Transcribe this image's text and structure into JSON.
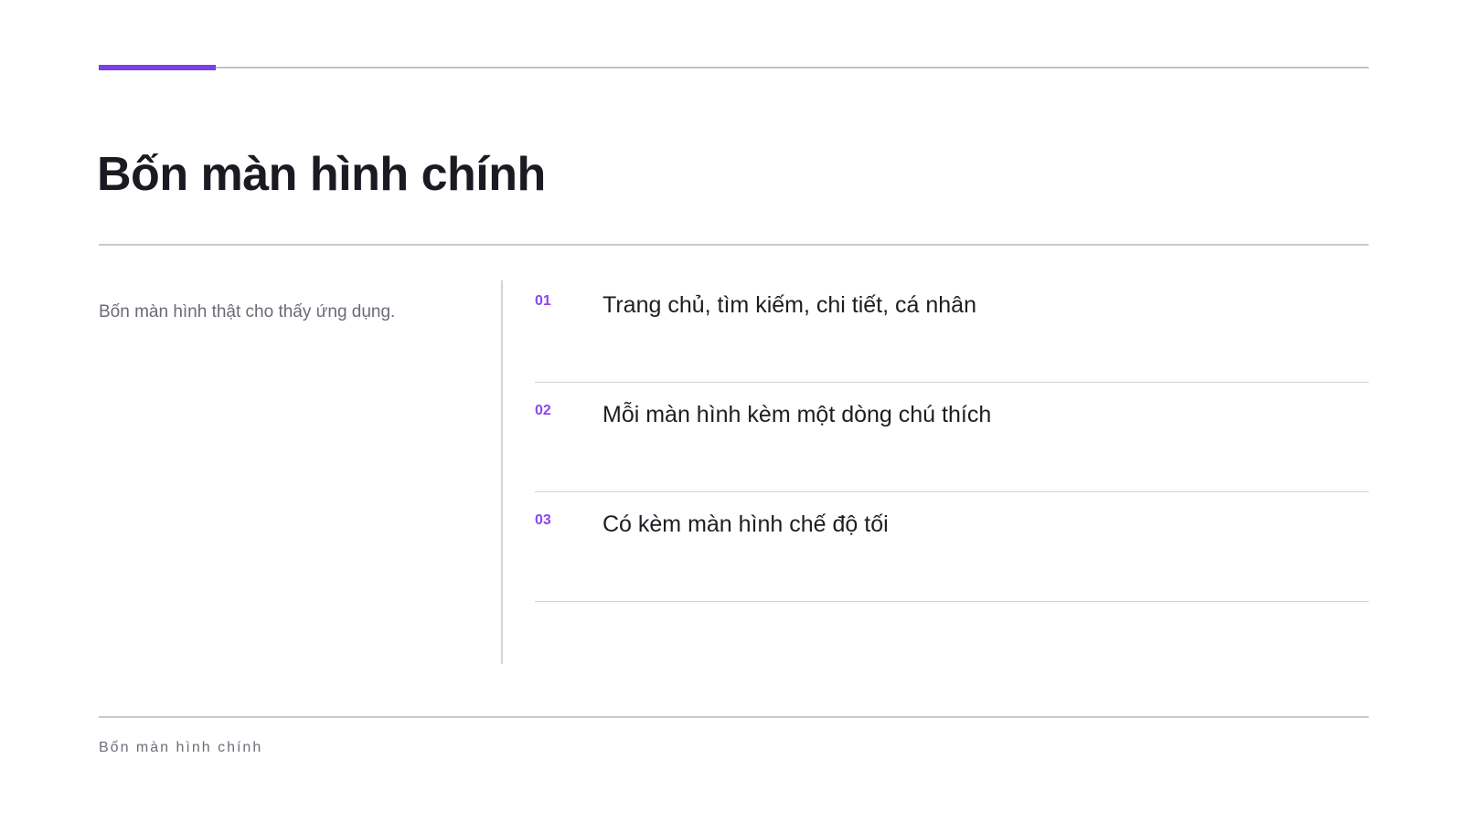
{
  "slide": {
    "title": "Bốn màn hình chính",
    "intro": "Bốn màn hình thật cho thấy ứng dụng.",
    "items": [
      {
        "number": "01",
        "text": "Trang chủ, tìm kiếm, chi tiết, cá nhân"
      },
      {
        "number": "02",
        "text": "Mỗi màn hình kèm một dòng chú thích"
      },
      {
        "number": "03",
        "text": "Có kèm màn hình chế độ tối"
      }
    ],
    "footer": "Bốn màn hình chính"
  },
  "colors": {
    "accent": "#7b3fe4",
    "number": "#8a48ec",
    "rule": "#c9c9cd",
    "title": "#1a1a22",
    "muted_text": "#6b6b78"
  }
}
